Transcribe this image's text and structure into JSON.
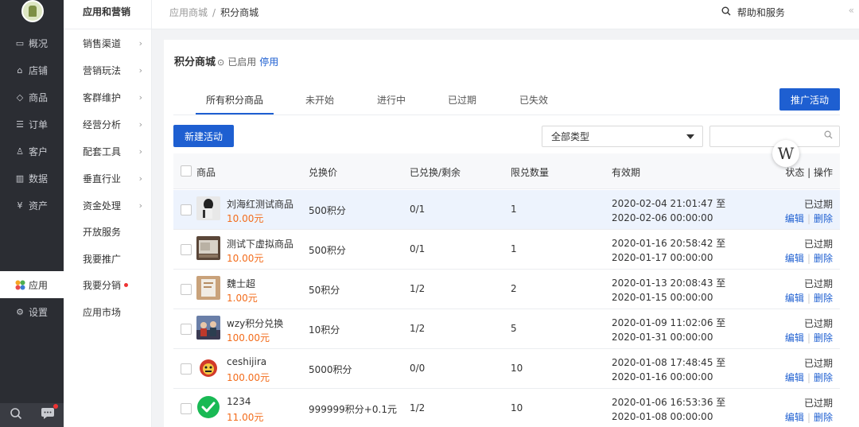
{
  "sidebar_main": {
    "items": [
      {
        "label": "概况",
        "icon": "monitor-icon"
      },
      {
        "label": "店铺",
        "icon": "store-icon"
      },
      {
        "label": "商品",
        "icon": "tag-icon"
      },
      {
        "label": "订单",
        "icon": "order-icon"
      },
      {
        "label": "客户",
        "icon": "user-icon"
      },
      {
        "label": "数据",
        "icon": "chart-icon"
      },
      {
        "label": "资产",
        "icon": "yen-icon"
      },
      {
        "label": "应用",
        "icon": "apps-icon"
      },
      {
        "label": "设置",
        "icon": "gear-icon"
      }
    ]
  },
  "sidebar_sub": {
    "title": "应用和营销",
    "items": [
      {
        "label": "销售渠道"
      },
      {
        "label": "营销玩法"
      },
      {
        "label": "客群维护"
      },
      {
        "label": "经营分析"
      },
      {
        "label": "配套工具"
      },
      {
        "label": "垂直行业"
      },
      {
        "label": "资金处理"
      },
      {
        "label": "开放服务"
      },
      {
        "label": "我要推广"
      },
      {
        "label": "我要分销"
      },
      {
        "label": "应用市场"
      }
    ]
  },
  "header": {
    "breadcrumb_root": "应用商城",
    "breadcrumb_sep": "/",
    "breadcrumb_current": "积分商城",
    "help": "帮助和服务",
    "collapse": "«"
  },
  "page": {
    "title": "积分商城",
    "status": "已启用",
    "stop": "停用",
    "tabs": [
      {
        "label": "所有积分商品"
      },
      {
        "label": "未开始"
      },
      {
        "label": "进行中"
      },
      {
        "label": "已过期"
      },
      {
        "label": "已失效"
      }
    ],
    "promo_button": "推广活动",
    "new_button": "新建活动",
    "type_select": "全部类型",
    "search_placeholder": "",
    "float_badge": "W"
  },
  "table": {
    "headers": {
      "product": "商品",
      "price": "兑换价",
      "redeemed": "已兑换/剩余",
      "limit": "限兑数量",
      "valid": "有效期",
      "status_ops": "状态 | 操作"
    },
    "rows": [
      {
        "name": "刘海红测试商品",
        "price": "10.00元",
        "points": "500积分",
        "redeemed": "0/1",
        "limit": "1",
        "start": "2020-02-04 21:01:47 至",
        "end": "2020-02-06 00:00:00",
        "status": "已过期",
        "edit": "编辑",
        "delete": "删除"
      },
      {
        "name": "测试下虚拟商品",
        "price": "10.00元",
        "points": "500积分",
        "redeemed": "0/1",
        "limit": "1",
        "start": "2020-01-16 20:58:42 至",
        "end": "2020-01-17 00:00:00",
        "status": "已过期",
        "edit": "编辑",
        "delete": "删除"
      },
      {
        "name": "魏士超",
        "price": "1.00元",
        "points": "50积分",
        "redeemed": "1/2",
        "limit": "2",
        "start": "2020-01-13 20:08:43 至",
        "end": "2020-01-15 00:00:00",
        "status": "已过期",
        "edit": "编辑",
        "delete": "删除"
      },
      {
        "name": "wzy积分兑换",
        "price": "100.00元",
        "points": "10积分",
        "redeemed": "1/2",
        "limit": "5",
        "start": "2020-01-09 11:02:06 至",
        "end": "2020-01-31 00:00:00",
        "status": "已过期",
        "edit": "编辑",
        "delete": "删除"
      },
      {
        "name": "ceshijira",
        "price": "100.00元",
        "points": "5000积分",
        "redeemed": "0/0",
        "limit": "10",
        "start": "2020-01-08 17:48:45 至",
        "end": "2020-01-16 00:00:00",
        "status": "已过期",
        "edit": "编辑",
        "delete": "删除"
      },
      {
        "name": "1234",
        "price": "11.00元",
        "points": "999999积分+0.1元",
        "redeemed": "1/2",
        "limit": "10",
        "start": "2020-01-06 16:53:36 至",
        "end": "2020-01-08 00:00:00",
        "status": "已过期",
        "edit": "编辑",
        "delete": "删除"
      }
    ]
  },
  "colors": {
    "brand_blue": "#1e5fd1",
    "price_orange": "#f36c1b",
    "sidebar_dark": "#2b2d33"
  }
}
